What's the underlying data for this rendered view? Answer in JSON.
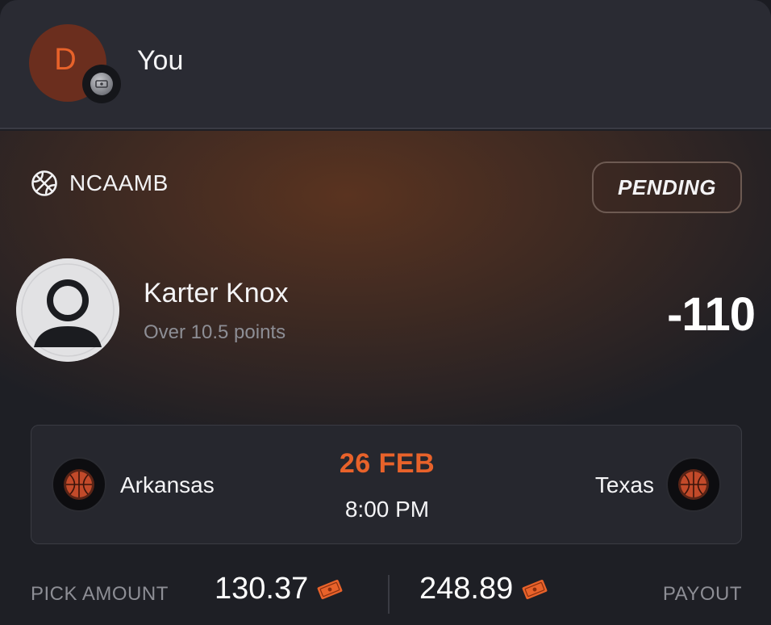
{
  "header": {
    "avatar_initial": "D",
    "user_name": "You"
  },
  "pick": {
    "league": "NCAAMB",
    "status": "PENDING",
    "player_name": "Karter Knox",
    "line": "Over 10.5 points",
    "odds": "-110"
  },
  "game": {
    "home_team": "Arkansas",
    "away_team": "Texas",
    "date": "26 FEB",
    "time": "8:00 PM"
  },
  "footer": {
    "pick_amount_label": "PICK AMOUNT",
    "pick_amount": "130.37",
    "payout": "248.89",
    "payout_label": "PAYOUT"
  },
  "icons": {
    "league": "basketball-icon",
    "badge": "coin-icon",
    "currency": "ticket-icon",
    "team_logo": "basketball-logo-icon",
    "player": "default-avatar-icon"
  },
  "colors": {
    "accent": "#e8622a",
    "background": "#1e1f25",
    "header": "#2a2b33",
    "muted_text": "#8d8e95"
  }
}
